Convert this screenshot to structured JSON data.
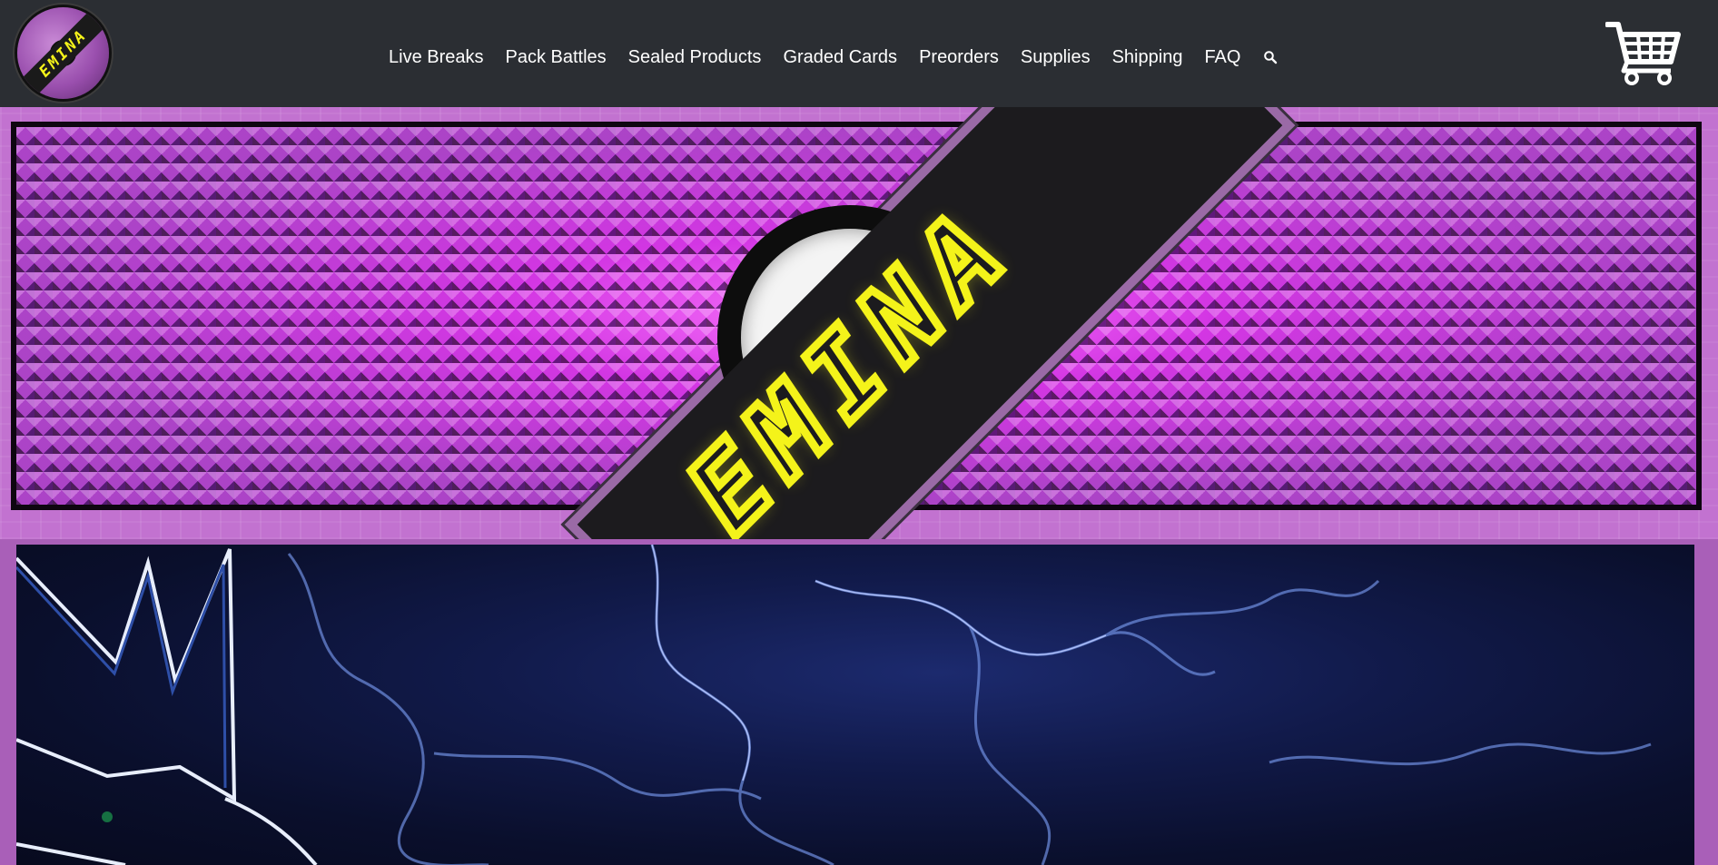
{
  "header": {
    "logo_text": "EMINA",
    "nav": [
      "Live Breaks",
      "Pack Battles",
      "Sealed Products",
      "Graded Cards",
      "Preorders",
      "Supplies",
      "Shipping",
      "FAQ"
    ],
    "icons": {
      "search": "search-icon",
      "cart": "cart-icon"
    }
  },
  "banner": {
    "brand": "EMINA"
  },
  "colors": {
    "header_bg": "#2b2e33",
    "page_bg": "#a95fb8",
    "accent_yellow": "#f4f31a",
    "stud_purple": "#b64bd0"
  }
}
